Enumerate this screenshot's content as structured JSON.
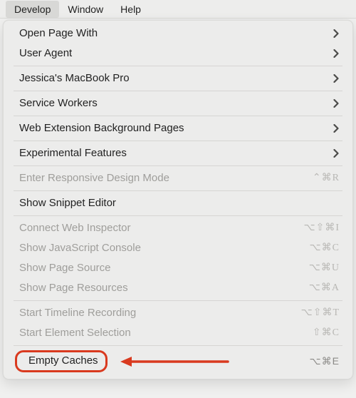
{
  "menubar": {
    "develop": "Develop",
    "window": "Window",
    "help": "Help"
  },
  "menu": {
    "open_page_with": "Open Page With",
    "user_agent": "User Agent",
    "device_name": "Jessica's MacBook Pro",
    "service_workers": "Service Workers",
    "web_ext_bg": "Web Extension Background Pages",
    "experimental": "Experimental Features",
    "responsive_mode": {
      "label": "Enter Responsive Design Mode",
      "shortcut": "⌃⌘R"
    },
    "snippet_editor": "Show Snippet Editor",
    "connect_inspector": {
      "label": "Connect Web Inspector",
      "shortcut": "⌥⇧⌘I"
    },
    "js_console": {
      "label": "Show JavaScript Console",
      "shortcut": "⌥⌘C"
    },
    "page_source": {
      "label": "Show Page Source",
      "shortcut": "⌥⌘U"
    },
    "page_resources": {
      "label": "Show Page Resources",
      "shortcut": "⌥⌘A"
    },
    "timeline": {
      "label": "Start Timeline Recording",
      "shortcut": "⌥⇧⌘T"
    },
    "element_sel": {
      "label": "Start Element Selection",
      "shortcut": "⇧⌘C"
    },
    "empty_caches": {
      "label": "Empty Caches",
      "shortcut": "⌥⌘E"
    }
  }
}
